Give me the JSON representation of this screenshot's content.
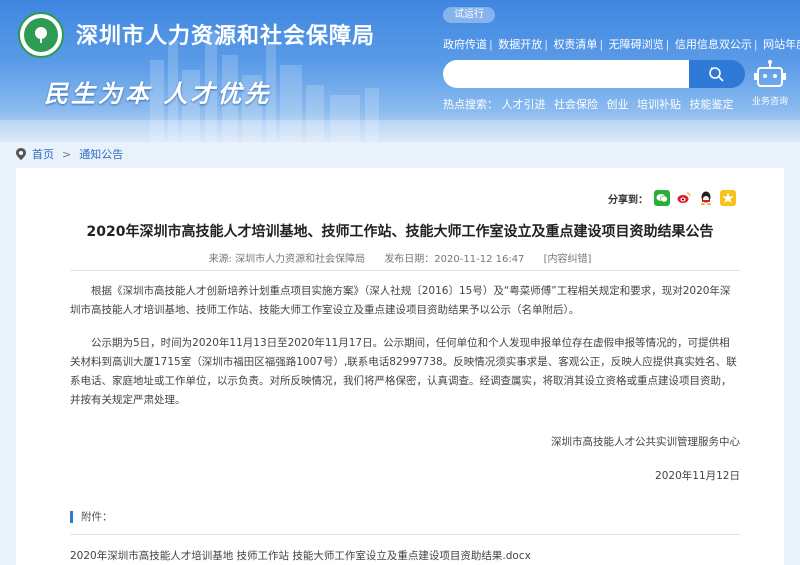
{
  "header": {
    "site_title": "深圳市人力资源和社会保障局",
    "slogan": "民生为本  人才优先",
    "trial_label": "试运行",
    "top_links": [
      "政府传道",
      "数据开放",
      "权责清单",
      "无障碍浏览",
      "信用信息双公示",
      "网站年度报表"
    ],
    "search": {
      "placeholder": ""
    },
    "hot_label": "热点搜索：",
    "hot_items": [
      "人才引进",
      "社会保险",
      "创业",
      "培训补贴",
      "技能鉴定"
    ],
    "consult_label": "业务咨询",
    "colors": {
      "brand": "#3f86e0",
      "logo_green": "#2e9b52"
    }
  },
  "breadcrumb": {
    "home": "首页",
    "separator": ">",
    "current": "通知公告"
  },
  "article": {
    "share_label": "分享到：",
    "share_icons": [
      "wechat-icon",
      "weibo-icon",
      "qq-icon",
      "qzone-icon"
    ],
    "title": "2020年深圳市高技能人才培训基地、技师工作站、技能大师工作室设立及重点建设项目资助结果公告",
    "source": "来源: 深圳市人力资源和社会保障局",
    "publish_date": "发布日期：2020-11-12 16:47",
    "error_link": "[内容纠错]",
    "paragraph1": "根据《深圳市高技能人才创新培养计划重点项目实施方案》（深人社规〔2016〕15号）及“粤菜师傅”工程相关规定和要求，现对2020年深圳市高技能人才培训基地、技师工作站、技能大师工作室设立及重点建设项目资助结果予以公示（名单附后）。",
    "paragraph2": "公示期为5日，时间为2020年11月13日至2020年11月17日。公示期间，任何单位和个人发现申报单位存在虚假申报等情况的，可提供相关材料到高训大厦1715室（深圳市福田区福强路1007号）,联系电话82997738。反映情况须实事求是、客观公正，反映人应提供真实姓名、联系电话、家庭地址或工作单位，以示负责。对所反映情况，我们将严格保密，认真调查。经调查属实，将取消其设立资格或重点建设项目资助，并按有关规定严肃处理。",
    "signature": "深圳市高技能人才公共实训管理服务中心",
    "sign_date": "2020年11月12日",
    "attachment_label": "附件：",
    "attachment_file": "2020年深圳市高技能人才培训基地 技师工作站 技能大师工作室设立及重点建设项目资助结果.docx"
  }
}
